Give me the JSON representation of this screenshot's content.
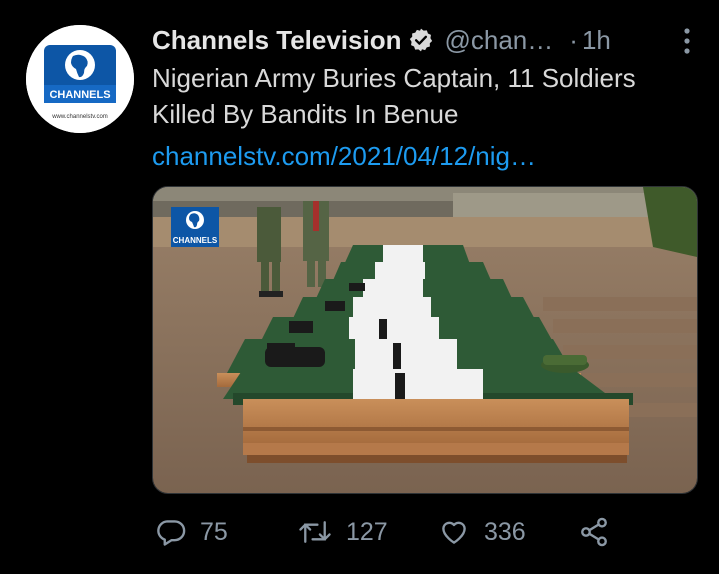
{
  "author": {
    "name": "Channels Television",
    "handle": "@chan…",
    "time": "1h",
    "avatar_text": "CHANNELS",
    "avatar_url_text": "www.channelstv.com"
  },
  "tweet": {
    "text": "Nigerian Army Buries Captain, 11 Soldiers Killed By Bandits In Benue",
    "link": "channelstv.com/2021/04/12/nig…"
  },
  "media": {
    "watermark": "CHANNELS"
  },
  "actions": {
    "replies": "75",
    "retweets": "127",
    "likes": "336"
  },
  "colors": {
    "background": "#000000",
    "link": "#1d9bf0",
    "secondary": "#8b98a5"
  }
}
